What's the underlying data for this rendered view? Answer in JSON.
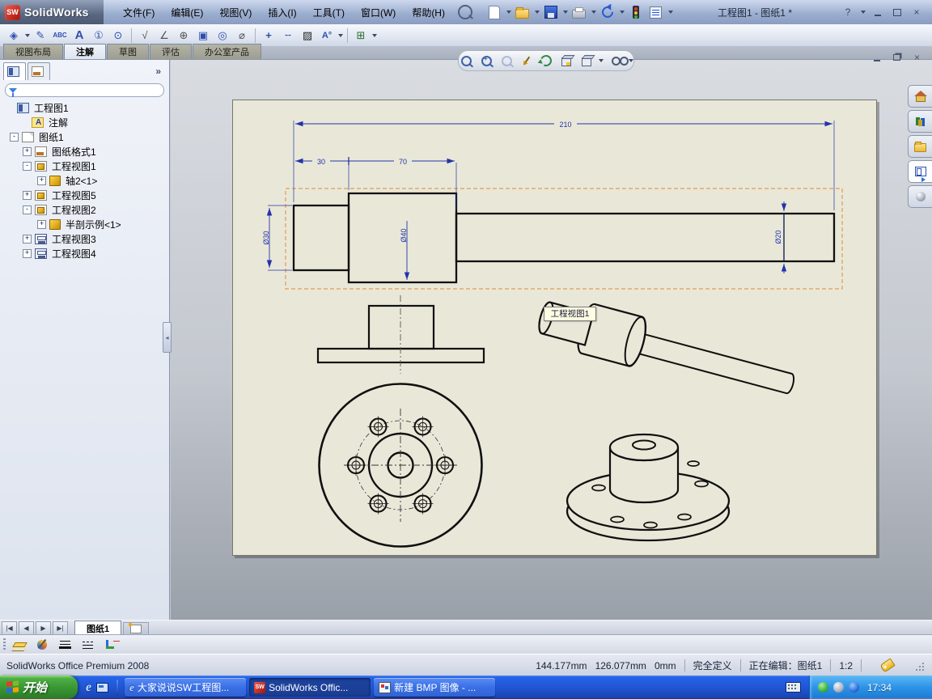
{
  "window": {
    "logo_text": "SW",
    "app_name": "SolidWorks",
    "doc_title": "工程图1 - 图纸1 *",
    "help_label": "?"
  },
  "menubar": {
    "items": [
      "文件(F)",
      "编辑(E)",
      "视图(V)",
      "插入(I)",
      "工具(T)",
      "窗口(W)",
      "帮助(H)"
    ]
  },
  "main_toolbar": {
    "icons": [
      "new-document",
      "open",
      "save",
      "print",
      "undo",
      "rebuild-traffic-light",
      "options-list"
    ]
  },
  "annotation_toolbar": {
    "items": [
      {
        "name": "smart-dimension",
        "glyph": "◈"
      },
      {
        "name": "model-items",
        "glyph": "✎"
      },
      {
        "name": "spell-checker",
        "glyph": "ABC"
      },
      {
        "name": "note",
        "glyph": "A"
      },
      {
        "name": "balloon",
        "glyph": "①"
      },
      {
        "name": "auto-balloon",
        "glyph": "⊙"
      },
      {
        "name": "surface-finish",
        "glyph": "√"
      },
      {
        "name": "weld-symbol",
        "glyph": "∠"
      },
      {
        "name": "geometric-tolerance",
        "glyph": "⊕"
      },
      {
        "name": "datum-feature",
        "glyph": "▣"
      },
      {
        "name": "datum-target",
        "glyph": "◎"
      },
      {
        "name": "hole-callout",
        "glyph": "⌀"
      },
      {
        "name": "center-mark",
        "glyph": "+"
      },
      {
        "name": "centerline",
        "glyph": "╌"
      },
      {
        "name": "area-hatch-fill",
        "glyph": "▨"
      },
      {
        "name": "blocks",
        "glyph": "A°"
      },
      {
        "name": "tables",
        "glyph": "⊞"
      }
    ]
  },
  "command_tabs": {
    "items": [
      "视图布局",
      "注解",
      "草图",
      "评估",
      "办公室产品"
    ],
    "active": "注解"
  },
  "feature_panel": {
    "filter_value": "",
    "tree": [
      {
        "label": "工程图1",
        "icon": "drawing-root",
        "expand": ""
      },
      {
        "label": "注解",
        "icon": "annotations-folder",
        "expand": ""
      },
      {
        "label": "图纸1",
        "icon": "sheet",
        "expand": "-"
      },
      {
        "label": "图纸格式1",
        "icon": "sheet-format",
        "expand": "+"
      },
      {
        "label": "工程视图1",
        "icon": "drawing-view",
        "expand": "-"
      },
      {
        "label": "轴2<1>",
        "icon": "part",
        "expand": "+"
      },
      {
        "label": "工程视图5",
        "icon": "drawing-view",
        "expand": "+"
      },
      {
        "label": "工程视图2",
        "icon": "drawing-view",
        "expand": "-"
      },
      {
        "label": "半剖示例<1>",
        "icon": "part",
        "expand": "+"
      },
      {
        "label": "工程视图3",
        "icon": "projected-view",
        "expand": "+"
      },
      {
        "label": "工程视图4",
        "icon": "projected-view",
        "expand": "+"
      }
    ]
  },
  "headsup_toolbar": {
    "icons": [
      "zoom-to-fit",
      "zoom-to-area",
      "zoom-previous",
      "pan-rotate",
      "refresh-view",
      "section-view",
      "view-orientation",
      "display-style"
    ]
  },
  "task_pane": {
    "tabs": [
      "solidworks-resources",
      "design-library",
      "file-explorer",
      "view-palette",
      "appearances"
    ]
  },
  "drawing": {
    "dimensions": {
      "overall": "210",
      "segment1": "30",
      "segment2": "70",
      "dia_small": "Ø30",
      "dia_large": "Ø40",
      "dia_shaft": "Ø20"
    },
    "tooltip": "工程视图1"
  },
  "sheet_bar": {
    "active_tab": "图纸1",
    "nav": [
      "first-sheet",
      "previous-sheet",
      "next-sheet",
      "last-sheet"
    ]
  },
  "format_toolbar": {
    "icons": [
      "layer-properties",
      "line-color",
      "line-thickness",
      "line-style",
      "hide-show-edges"
    ]
  },
  "status_bar": {
    "product": "SolidWorks Office Premium 2008",
    "x": "144.177mm",
    "y": "126.077mm",
    "z": "0mm",
    "state": "完全定义",
    "editing": "正在编辑：图纸1",
    "scale": "1:2"
  },
  "taskbar": {
    "start_label": "开始",
    "quick_launch": [
      "internet-explorer",
      "show-desktop"
    ],
    "tasks": [
      {
        "icon": "internet-explorer",
        "label": "大家说说SW工程图..."
      },
      {
        "icon": "solidworks",
        "label": "SolidWorks Offic..."
      },
      {
        "icon": "bmp-image",
        "label": "新建 BMP 图像 - ..."
      }
    ],
    "tray_icons": [
      "keyboard-layout",
      "green-status",
      "gray-status",
      "network-globe"
    ],
    "time": "17:34"
  }
}
